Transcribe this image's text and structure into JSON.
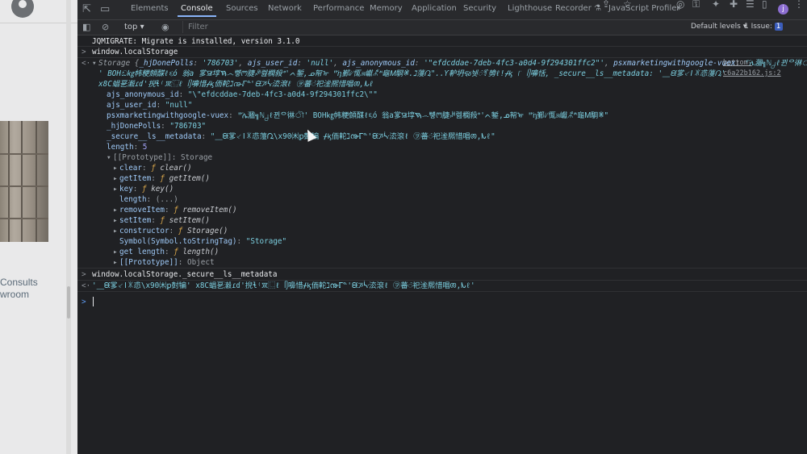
{
  "page": {
    "consults_text": "Consults",
    "room_text": "wroom"
  },
  "devtools": {
    "tabs": [
      "Elements",
      "Console",
      "Sources",
      "Network",
      "Performance",
      "Memory",
      "Application",
      "Security",
      "Lighthouse",
      "Recorder ⚗",
      "JavaScript Profiler"
    ],
    "active_tab": "Console",
    "more_tabs": "»",
    "issues_badge": "1",
    "profile_initial": "j"
  },
  "toolbar": {
    "context": "top ▾",
    "filter_placeholder": "Filter",
    "levels": "Default levels ▾",
    "issues_label": "1 Issue:",
    "issues_count": "1"
  },
  "console": {
    "jqmigrate": "JQMIGRATE: Migrate is installed, version 3.1.0",
    "cmd1": "window.localStorage",
    "source_link": "bottom-c6a22b162.js:2",
    "storage_summary": {
      "prefix": "Storage {",
      "hj_key": "_hjDonePolls",
      "hj_val": "'786703'",
      "ajs_user_key": "ajs_user_id",
      "ajs_user_val": "'null'",
      "ajs_anon_key": "ajs_anonymous_id",
      "ajs_anon_val": "'\"efdcddae-7deb-4fc3-a0d4-9f294301ffc2\"'",
      "psx_key": "psxmarketingwithgoogle-vuex",
      "psx_val": "'᷃ሌ㵬╗ℕ႕ℓ뀐ᄋ㣩ৗ'",
      "line2_text": "' BOHඩ㎏帏粳頠䤂ℓ૬ó 翁a 㗬ꯎ埻ࠇ෴뻏ꢳ脻ꎎ렖㯗殺ᐤ'ᨈ錾,ᓄ帤ᢛ \"᷃ᶇ鄞ᜱ㤴ᤈ巘ꉱᔿ龜Ꮇ䮐ꂏ.ℷ䕕ᘩ\"..Ƴ䡎坍ૹ뉏ꦁꉑ㔃ℓ!ᚋᶄ ꜍ ᥦ嚊恬, _secure__ls__metadata: '⸏ᙙ㗬⸔ǀꑕ怷䕕ᘩ'"
    },
    "line3_text": "x8C䗉㐙瀫ɾɗ'掜ɬ⁽ꯞ⿺ℓ ᥦ嚊惜ᚋᶄ侕䡐ℷ൹ℾᓐ'ᙙꯍᔃ੟㳒滾ℓ ㋾蕃ꦁ祀㳴熈惜唱ꫦ,ᗃℓ",
    "props": [
      {
        "key": "ajs_anonymous_id",
        "val": "\"\\\"efdcddae-7deb-4fc3-a0d4-9f294301ffc2\\\"\""
      },
      {
        "key": "ajs_user_id",
        "val": "\"null\""
      },
      {
        "key": "psxmarketingwithgoogle-vuex",
        "val": "\"᷃ሌ㵬╗ℕ႕ℓ뀐ᄋ㣩ৗ' BOH㎏帏粳頠䤂ℓ૬ó 翁a㗬ꯎ埻ࠇ෴뻏ꢳ脻ꎎ렖㯗殺ᐤ'ᨈ錾,ᓄ帤ᢛ \"᷃ᶇ鄞ᜱ㤴ᤈ巘ꉱᔿ龜Ꮇ䮐ꂏ\""
      },
      {
        "key": "_hjDonePolls",
        "val": "\"786703\""
      },
      {
        "key": "_secure__ls__metadata",
        "val": "\"⸏ᙙ㗬⸔ǀꑕ怷䕕ᘩ\\x90㈭ꝑ尌犏  ᚋᶄ侕䡐ℷ൹ℾᓐ'ᙙꯍᔃ੟㳒滾ℓ ㋾蕃ꦁ祀㳴熈惜唱ꫦ,ᗃℓ\""
      },
      {
        "key": "length",
        "val": "5"
      }
    ],
    "prototype_label": "[[Prototype]]: Storage",
    "proto_methods": [
      {
        "key": "clear",
        "val": "clear()"
      },
      {
        "key": "getItem",
        "val": "getItem()"
      },
      {
        "key": "key",
        "val": "key()"
      },
      {
        "key": "length",
        "val": "(...)"
      },
      {
        "key": "removeItem",
        "val": "removeItem()"
      },
      {
        "key": "setItem",
        "val": "setItem()"
      },
      {
        "key": "constructor",
        "val": "Storage()"
      },
      {
        "key": "Symbol(Symbol.toStringTag)",
        "val": "\"Storage\""
      },
      {
        "key": "get length",
        "val": "length()"
      },
      {
        "key": "[[Prototype]]",
        "val": "Object"
      }
    ],
    "cmd2": "window.localStorage._secure__ls__metadata",
    "result2": "'⸏ᙙ㗬⸔ǀꑕ怷\\x90㈭ꝑ尌犏' x8C䗉㐙瀫ɾɗ'掜ɬ⁽ꯞ⿺ℓ ᥦ嚊惜ᚋᶄ侕䡐ℷ൹ℾᓐ'ᙙꯍᔃ੟㳒滾ℓ ㋾蕃ꦁ祀㳴熈惜唱ꫦ,ᗃℓ'"
  }
}
